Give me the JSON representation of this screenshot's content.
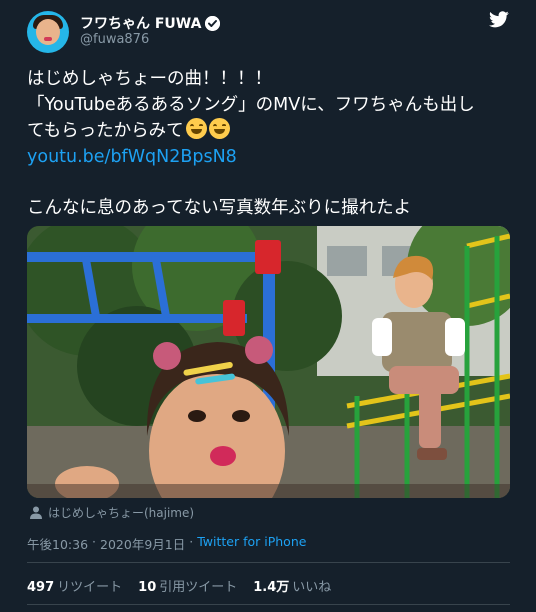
{
  "author": {
    "display_name": "フワちゃん FUWA",
    "handle": "@fuwa876",
    "avatar_colors": {
      "bg": "#25b6e8",
      "face": "#e9b48c",
      "hair": "#2a1b12"
    }
  },
  "tweet": {
    "line1": "はじめしゃちょーの曲！！！！",
    "line2": "「YouTubeあるあるソング」のMVに、フワちゃんも出し",
    "line3": "てもらったからみて",
    "emoji": [
      "grinning-squinting-face",
      "grinning-squinting-face"
    ],
    "link": "youtu.be/bfWqN2BpsN8",
    "line4": "こんなに息のあってない写真数年ぶりに撮れたよ"
  },
  "media": {
    "photo_icon": "photo-of-two-people-at-playground",
    "tagged_user": "はじめしゃちょー(hajime)",
    "tag_icon": "person-icon"
  },
  "meta": {
    "time": "午後10:36",
    "separator1": "·",
    "date": "2020年9月1日",
    "separator2": "·",
    "source": "Twitter for iPhone"
  },
  "stats": [
    {
      "count": "497",
      "label": "リツイート"
    },
    {
      "count": "10",
      "label": "引用ツイート"
    },
    {
      "count": "1.4万",
      "label": "いいね"
    }
  ],
  "colors": {
    "background": "#15202b",
    "text": "#ffffff",
    "secondary": "#8899a6",
    "link": "#1da1f2",
    "divider": "#38444d"
  }
}
